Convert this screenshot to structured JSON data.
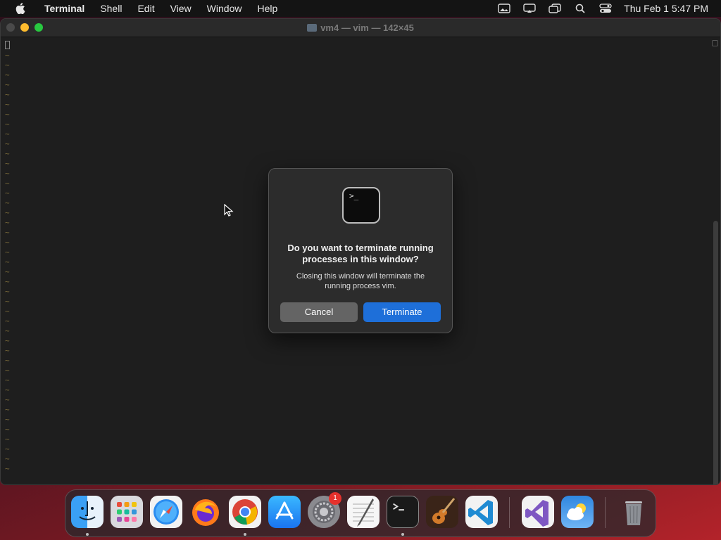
{
  "menubar": {
    "app_name": "Terminal",
    "items": [
      "Shell",
      "Edit",
      "View",
      "Window",
      "Help"
    ],
    "clock": "Thu Feb 1  5:47 PM"
  },
  "window": {
    "title": "vm4 — vim — 142×45"
  },
  "dialog": {
    "icon_text": ">_",
    "title": "Do you want to terminate running processes in this window?",
    "message": "Closing this window will terminate the running process vim.",
    "cancel_label": "Cancel",
    "terminate_label": "Terminate"
  },
  "dock": {
    "apps": [
      "finder",
      "launchpad",
      "safari",
      "firefox",
      "chrome",
      "app-store",
      "system-settings",
      "textedit",
      "terminal",
      "instruments",
      "vscode",
      "visual-studio",
      "weather",
      "trash"
    ],
    "system_settings_badge": "1"
  },
  "colors": {
    "accent": "#1e6fd9",
    "window_bg": "#1e1e1e",
    "dialog_bg": "#2c2c2c"
  }
}
